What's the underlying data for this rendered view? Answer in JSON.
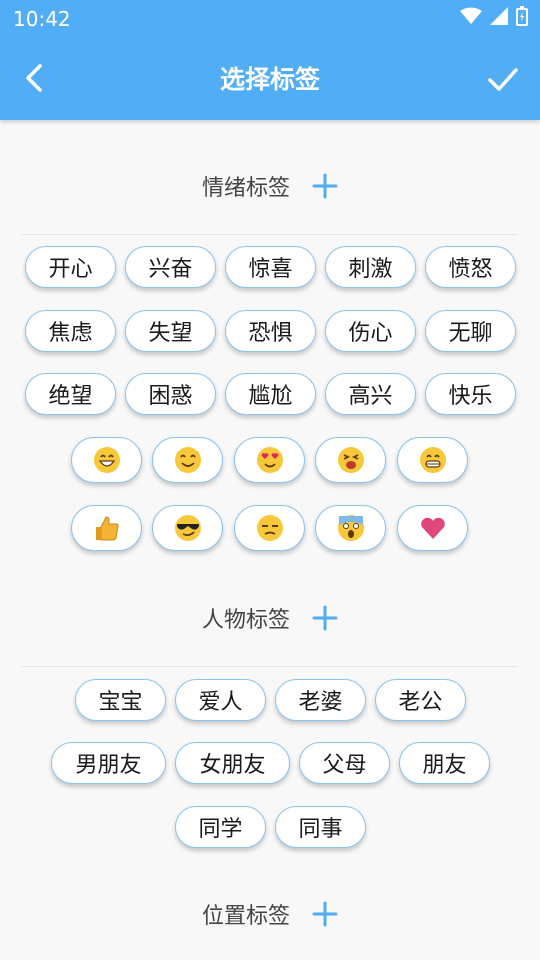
{
  "status": {
    "time": "10:42"
  },
  "header": {
    "title": "选择标签"
  },
  "sections": {
    "mood": {
      "title": "情绪标签",
      "tags": [
        "开心",
        "兴奋",
        "惊喜",
        "刺激",
        "愤怒",
        "焦虑",
        "失望",
        "恐惧",
        "伤心",
        "无聊",
        "绝望",
        "困惑",
        "尴尬",
        "高兴",
        "快乐"
      ],
      "emojis": [
        "grinning-face-icon",
        "smiling-face-icon",
        "heart-eyes-face-icon",
        "tired-face-icon",
        "grinning-teeth-face-icon",
        "thumbs-up-icon",
        "sunglasses-face-icon",
        "unamused-face-icon",
        "screaming-face-icon",
        "heart-icon"
      ]
    },
    "people": {
      "title": "人物标签",
      "tags": [
        "宝宝",
        "爱人",
        "老婆",
        "老公",
        "男朋友",
        "女朋友",
        "父母",
        "朋友",
        "同学",
        "同事"
      ]
    },
    "location": {
      "title": "位置标签"
    }
  },
  "colors": {
    "appbar": "#51adf6",
    "accent": "#51adf6",
    "chip_border": "#8bc4ef"
  }
}
